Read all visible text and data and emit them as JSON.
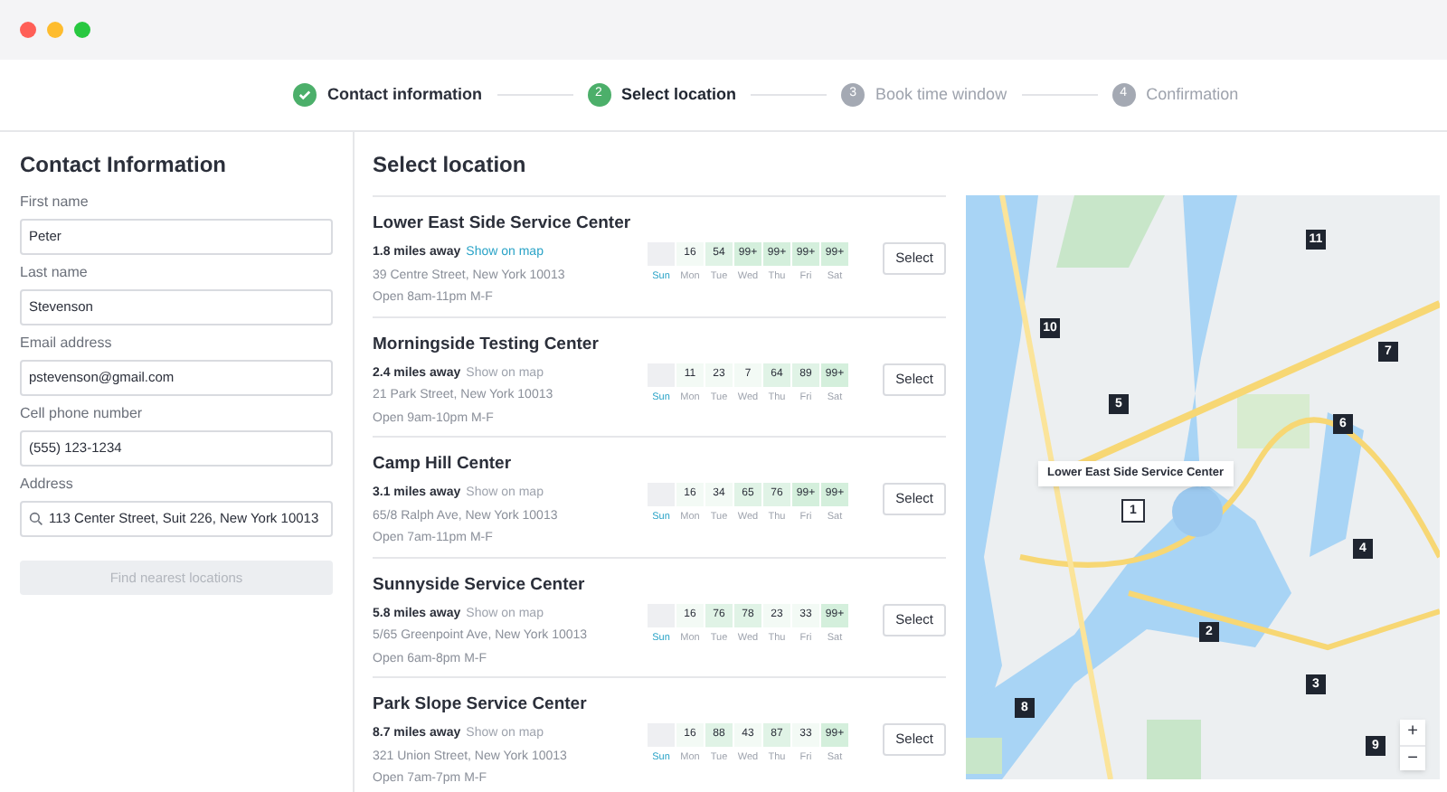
{
  "steps": [
    {
      "label": "Contact information",
      "completed": true,
      "selected": false
    },
    {
      "number": "2",
      "label": "Select location",
      "completed": false,
      "selected": true
    },
    {
      "number": "3",
      "label": "Book time window",
      "completed": false,
      "selected": false
    },
    {
      "number": "4",
      "label": "Confirmation",
      "completed": false,
      "selected": false
    }
  ],
  "contact": {
    "title": "Contact Information",
    "fields": [
      {
        "label": "First name",
        "value": "Peter",
        "kind": "text"
      },
      {
        "label": "Last name",
        "value": "Stevenson",
        "kind": "text"
      },
      {
        "label": "Email address",
        "value": "pstevenson@gmail.com",
        "kind": "text"
      },
      {
        "label": "Cell phone number",
        "value": "(555) 123-1234",
        "kind": "text"
      },
      {
        "label": "Address",
        "value": "113 Center Street, Suit 226, New York 10013",
        "kind": "search"
      }
    ],
    "button": {
      "label": "Find nearest locations",
      "disabled": true
    }
  },
  "locations_title": "Select location",
  "locations": [
    {
      "name": "Lower East Side Service Center",
      "distance": "1.8 miles away",
      "link": "Show on map",
      "link_active": true,
      "address": "39 Centre Street, New York 10013",
      "hours": "Open 8am-11pm M-F",
      "slots": [
        {
          "kind": "none"
        },
        {
          "value": "16",
          "kind": "low"
        },
        {
          "value": "54",
          "kind": "mid"
        },
        {
          "value": "99+",
          "kind": "high"
        },
        {
          "value": "99+",
          "kind": "high"
        },
        {
          "value": "99+",
          "kind": "high"
        },
        {
          "value": "99+",
          "kind": "high"
        }
      ],
      "days": [
        {
          "label": "Sun",
          "selected": true
        },
        {
          "label": "Mon",
          "selected": false
        },
        {
          "label": "Tue",
          "selected": false
        },
        {
          "label": "Wed",
          "selected": false
        },
        {
          "label": "Thu",
          "selected": false
        },
        {
          "label": "Fri",
          "selected": false
        },
        {
          "label": "Sat",
          "selected": false
        }
      ],
      "button": "Select"
    },
    {
      "name": "Morningside Testing Center",
      "distance": "2.4 miles away",
      "link": "Show on map",
      "link_active": false,
      "address": "21 Park Street, New York 10013",
      "hours": "Open 9am-10pm M-F",
      "slots": [
        {
          "kind": "none"
        },
        {
          "value": "11",
          "kind": "low"
        },
        {
          "value": "23",
          "kind": "low"
        },
        {
          "value": "7",
          "kind": "low"
        },
        {
          "value": "64",
          "kind": "mid"
        },
        {
          "value": "89",
          "kind": "mid"
        },
        {
          "value": "99+",
          "kind": "high"
        }
      ],
      "days": [
        {
          "label": "Sun",
          "selected": true
        },
        {
          "label": "Mon",
          "selected": false
        },
        {
          "label": "Tue",
          "selected": false
        },
        {
          "label": "Wed",
          "selected": false
        },
        {
          "label": "Thu",
          "selected": false
        },
        {
          "label": "Fri",
          "selected": false
        },
        {
          "label": "Sat",
          "selected": false
        }
      ],
      "button": "Select"
    },
    {
      "name": "Camp Hill Center",
      "distance": "3.1 miles away",
      "link": "Show on map",
      "link_active": false,
      "address": "65/8 Ralph Ave, New York 10013",
      "hours": "Open 7am-11pm M-F",
      "slots": [
        {
          "kind": "none"
        },
        {
          "value": "16",
          "kind": "low"
        },
        {
          "value": "34",
          "kind": "low"
        },
        {
          "value": "65",
          "kind": "mid"
        },
        {
          "value": "76",
          "kind": "mid"
        },
        {
          "value": "99+",
          "kind": "high"
        },
        {
          "value": "99+",
          "kind": "high"
        }
      ],
      "days": [
        {
          "label": "Sun",
          "selected": true
        },
        {
          "label": "Mon",
          "selected": false
        },
        {
          "label": "Tue",
          "selected": false
        },
        {
          "label": "Wed",
          "selected": false
        },
        {
          "label": "Thu",
          "selected": false
        },
        {
          "label": "Fri",
          "selected": false
        },
        {
          "label": "Sat",
          "selected": false
        }
      ],
      "button": "Select"
    },
    {
      "name": "Sunnyside Service Center",
      "distance": "5.8 miles away",
      "link": "Show on map",
      "link_active": false,
      "address": "5/65 Greenpoint Ave, New York 10013",
      "hours": "Open 6am-8pm M-F",
      "slots": [
        {
          "kind": "none"
        },
        {
          "value": "16",
          "kind": "low"
        },
        {
          "value": "76",
          "kind": "mid"
        },
        {
          "value": "78",
          "kind": "mid"
        },
        {
          "value": "23",
          "kind": "low"
        },
        {
          "value": "33",
          "kind": "low"
        },
        {
          "value": "99+",
          "kind": "high"
        }
      ],
      "days": [
        {
          "label": "Sun",
          "selected": true
        },
        {
          "label": "Mon",
          "selected": false
        },
        {
          "label": "Tue",
          "selected": false
        },
        {
          "label": "Wed",
          "selected": false
        },
        {
          "label": "Thu",
          "selected": false
        },
        {
          "label": "Fri",
          "selected": false
        },
        {
          "label": "Sat",
          "selected": false
        }
      ],
      "button": "Select"
    },
    {
      "name": "Park Slope Service Center",
      "distance": "8.7 miles away",
      "link": "Show on map",
      "link_active": false,
      "address": "321 Union Street, New York 10013",
      "hours": "Open 7am-7pm M-F",
      "slots": [
        {
          "kind": "none"
        },
        {
          "value": "16",
          "kind": "low"
        },
        {
          "value": "88",
          "kind": "mid"
        },
        {
          "value": "43",
          "kind": "low"
        },
        {
          "value": "87",
          "kind": "mid"
        },
        {
          "value": "33",
          "kind": "low"
        },
        {
          "value": "99+",
          "kind": "high"
        }
      ],
      "days": [
        {
          "label": "Sun",
          "selected": true
        },
        {
          "label": "Mon",
          "selected": false
        },
        {
          "label": "Tue",
          "selected": false
        },
        {
          "label": "Wed",
          "selected": false
        },
        {
          "label": "Thu",
          "selected": false
        },
        {
          "label": "Fri",
          "selected": false
        },
        {
          "label": "Sat",
          "selected": false
        }
      ],
      "button": "Select"
    }
  ],
  "map": {
    "kind": "picture",
    "tooltip": "Lower East Side Service Center",
    "zoom_in": "+",
    "zoom_out": "−",
    "pins": [
      {
        "number": "11",
        "selected": false
      },
      {
        "number": "10",
        "selected": false
      },
      {
        "number": "7",
        "selected": false
      },
      {
        "number": "5",
        "selected": false
      },
      {
        "number": "6",
        "selected": false
      },
      {
        "number": "1",
        "selected": true
      },
      {
        "number": "4",
        "selected": false
      },
      {
        "number": "2",
        "selected": false
      },
      {
        "number": "3",
        "selected": false
      },
      {
        "number": "8",
        "selected": false
      },
      {
        "number": "9",
        "selected": false
      }
    ]
  }
}
